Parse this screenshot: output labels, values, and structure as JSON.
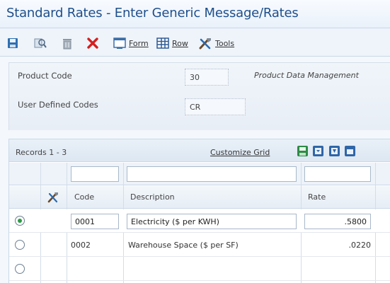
{
  "window": {
    "title": "Standard Rates - Enter Generic Message/Rates"
  },
  "toolbar": {
    "save_icon": "save-icon",
    "find_icon": "find-icon",
    "delete_icon": "delete-icon",
    "cancel_icon": "cancel-icon",
    "form_label": "Form",
    "row_label": "Row",
    "tools_label": "Tools"
  },
  "header": {
    "product_code_label": "Product Code",
    "product_code_value": "30",
    "product_code_desc": "Product Data Management",
    "udc_label": "User Defined Codes",
    "udc_value": "CR"
  },
  "grid": {
    "records_label": "Records 1 - 3",
    "customize_label": "Customize Grid",
    "columns": {
      "code": "Code",
      "description": "Description",
      "rate": "Rate"
    },
    "rows": [
      {
        "code": "0001",
        "description": "Electricity ($ per KWH)",
        "rate": ".5800",
        "selected": true
      },
      {
        "code": "0002",
        "description": "Warehouse Space ($ per SF)",
        "rate": ".0220",
        "selected": false
      },
      {
        "code": "",
        "description": "",
        "rate": "",
        "selected": false
      }
    ]
  },
  "colors": {
    "title": "#1e4f8c",
    "accent_green": "#2d9b45",
    "cancel_red": "#d41f1f"
  }
}
